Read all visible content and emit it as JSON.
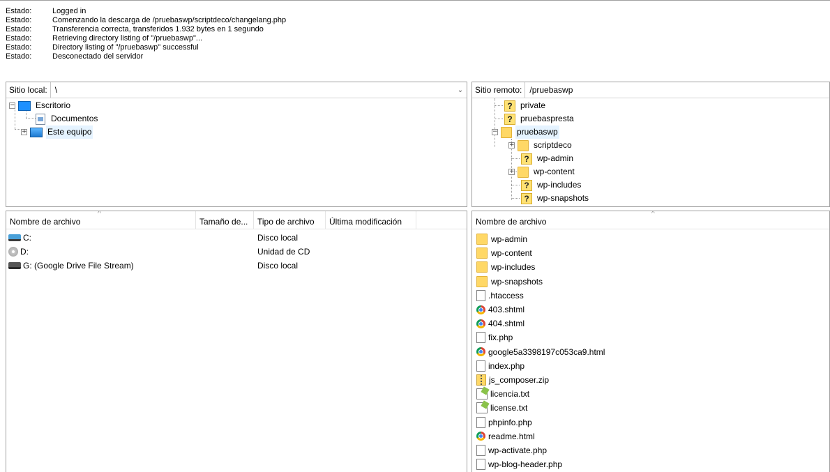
{
  "log": {
    "entries": [
      {
        "label": "Estado:",
        "message": "Logged in"
      },
      {
        "label": "Estado:",
        "message": "Comenzando la descarga de /pruebaswp/scriptdeco/changelang.php"
      },
      {
        "label": "Estado:",
        "message": "Transferencia correcta, transferidos 1.932 bytes en 1 segundo"
      },
      {
        "label": "Estado:",
        "message": "Retrieving directory listing of \"/pruebaswp\"..."
      },
      {
        "label": "Estado:",
        "message": "Directory listing of \"/pruebaswp\" successful"
      },
      {
        "label": "Estado:",
        "message": "Desconectado del servidor"
      }
    ]
  },
  "local": {
    "site_label": "Sitio local:",
    "site_path": "\\",
    "tree": [
      {
        "label": "Escritorio",
        "icon": "desktop-icon",
        "expander": "−"
      },
      {
        "label": "Documentos",
        "icon": "documents-icon"
      },
      {
        "label": "Este equipo",
        "icon": "computer-icon",
        "expander": "+"
      }
    ],
    "columns": [
      "Nombre de archivo",
      "Tamaño de...",
      "Tipo de archivo",
      "Última modificación"
    ],
    "files": [
      {
        "name": "C:",
        "type": "Disco local",
        "icon": "hard-drive-icon"
      },
      {
        "name": "D:",
        "type": "Unidad de CD",
        "icon": "cd-drive-icon"
      },
      {
        "name": "G: (Google Drive File Stream)",
        "type": "Disco local",
        "icon": "drive-icon"
      }
    ]
  },
  "remote": {
    "site_label": "Sitio remoto:",
    "site_path": "/pruebaswp",
    "tree": [
      {
        "label": "private",
        "icon": "unknown-folder-icon"
      },
      {
        "label": "pruebaspresta",
        "icon": "unknown-folder-icon"
      },
      {
        "label": "pruebaswp",
        "icon": "folder-icon",
        "expander": "−"
      },
      {
        "label": "scriptdeco",
        "icon": "folder-icon",
        "expander": "+"
      },
      {
        "label": "wp-admin",
        "icon": "unknown-folder-icon"
      },
      {
        "label": "wp-content",
        "icon": "folder-icon",
        "expander": "+"
      },
      {
        "label": "wp-includes",
        "icon": "unknown-folder-icon"
      },
      {
        "label": "wp-snapshots",
        "icon": "unknown-folder-icon"
      }
    ],
    "columns": [
      "Nombre de archivo"
    ],
    "files": [
      {
        "name": "wp-admin",
        "icon": "folder-icon"
      },
      {
        "name": "wp-content",
        "icon": "folder-icon"
      },
      {
        "name": "wp-includes",
        "icon": "folder-icon"
      },
      {
        "name": "wp-snapshots",
        "icon": "folder-icon"
      },
      {
        "name": ".htaccess",
        "icon": "file-icon"
      },
      {
        "name": "403.shtml",
        "icon": "chrome-icon"
      },
      {
        "name": "404.shtml",
        "icon": "chrome-icon"
      },
      {
        "name": "fix.php",
        "icon": "file-icon"
      },
      {
        "name": "google5a3398197c053ca9.html",
        "icon": "chrome-icon"
      },
      {
        "name": "index.php",
        "icon": "file-icon"
      },
      {
        "name": "js_composer.zip",
        "icon": "zip-icon"
      },
      {
        "name": "licencia.txt",
        "icon": "text-file-icon"
      },
      {
        "name": "license.txt",
        "icon": "text-file-icon"
      },
      {
        "name": "phpinfo.php",
        "icon": "file-icon"
      },
      {
        "name": "readme.html",
        "icon": "chrome-icon"
      },
      {
        "name": "wp-activate.php",
        "icon": "file-icon"
      },
      {
        "name": "wp-blog-header.php",
        "icon": "file-icon"
      }
    ]
  }
}
